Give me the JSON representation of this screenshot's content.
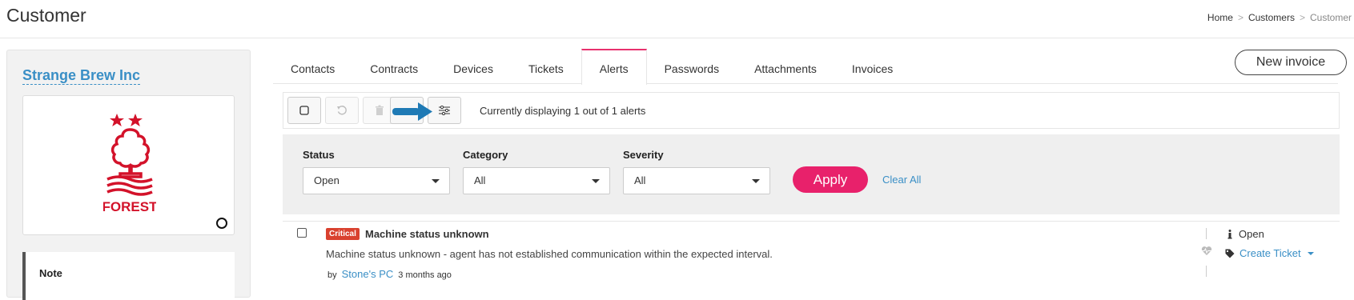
{
  "header": {
    "title": "Customer",
    "breadcrumb": {
      "home": "Home",
      "customers": "Customers",
      "current": "Customer",
      "separator": ">"
    }
  },
  "customer": {
    "name": "Strange Brew Inc",
    "logo_text": "FOREST",
    "note_label": "Note"
  },
  "tabs": [
    {
      "label": "Contacts",
      "active": false
    },
    {
      "label": "Contracts",
      "active": false
    },
    {
      "label": "Devices",
      "active": false
    },
    {
      "label": "Tickets",
      "active": false
    },
    {
      "label": "Alerts",
      "active": true
    },
    {
      "label": "Passwords",
      "active": false
    },
    {
      "label": "Attachments",
      "active": false
    },
    {
      "label": "Invoices",
      "active": false
    }
  ],
  "actions": {
    "new_invoice": "New invoice"
  },
  "toolbar": {
    "status": "Currently displaying 1 out of 1 alerts",
    "buttons": [
      "select-all-icon",
      "refresh-icon",
      "trash-icon",
      "filter-settings-icon"
    ]
  },
  "filters": {
    "status": {
      "label": "Status",
      "value": "Open"
    },
    "category": {
      "label": "Category",
      "value": "All"
    },
    "severity": {
      "label": "Severity",
      "value": "All"
    },
    "apply": "Apply",
    "clear": "Clear All"
  },
  "alerts": [
    {
      "severity": "Critical",
      "title": "Machine status unknown",
      "description": "Machine status unknown - agent has not established communication within the expected interval.",
      "by_label": "by",
      "device": "Stone's PC",
      "time": "3 months ago",
      "status": "Open",
      "ticket_action": "Create Ticket"
    }
  ],
  "colors": {
    "accent": "#e8216b",
    "link": "#3a8fc6",
    "critical": "#d9412f",
    "arrow": "#1f7ab5",
    "logo_red": "#d3122a"
  }
}
